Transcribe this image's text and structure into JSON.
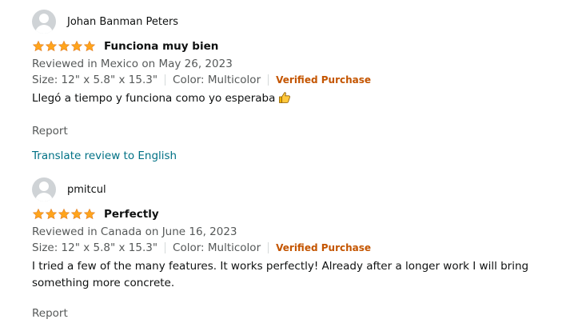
{
  "reviews": [
    {
      "reviewer": "Johan Banman Peters",
      "rating": 5,
      "title": "Funciona muy bien",
      "reviewed_in": "Reviewed in Mexico on May 26, 2023",
      "size": "Size: 12\" x 5.8\" x 15.3\"",
      "color": "Color: Multicolor",
      "verified": "Verified Purchase",
      "body": "Llegó a tiempo y funciona como yo esperaba",
      "report": "Report",
      "translate": "Translate review to English"
    },
    {
      "reviewer": "pmitcul",
      "rating": 5,
      "title": "Perfectly",
      "reviewed_in": "Reviewed in Canada on June 16, 2023",
      "size": "Size: 12\" x 5.8\" x 15.3\"",
      "color": "Color: Multicolor",
      "verified": "Verified Purchase",
      "body": "I tried a few of the many features. It works perfectly! Already after a longer work I will bring something more concrete.",
      "report": "Report"
    }
  ],
  "colors": {
    "star": "#ffa41c",
    "verified": "#c45500",
    "link": "#007185",
    "muted": "#565959"
  }
}
